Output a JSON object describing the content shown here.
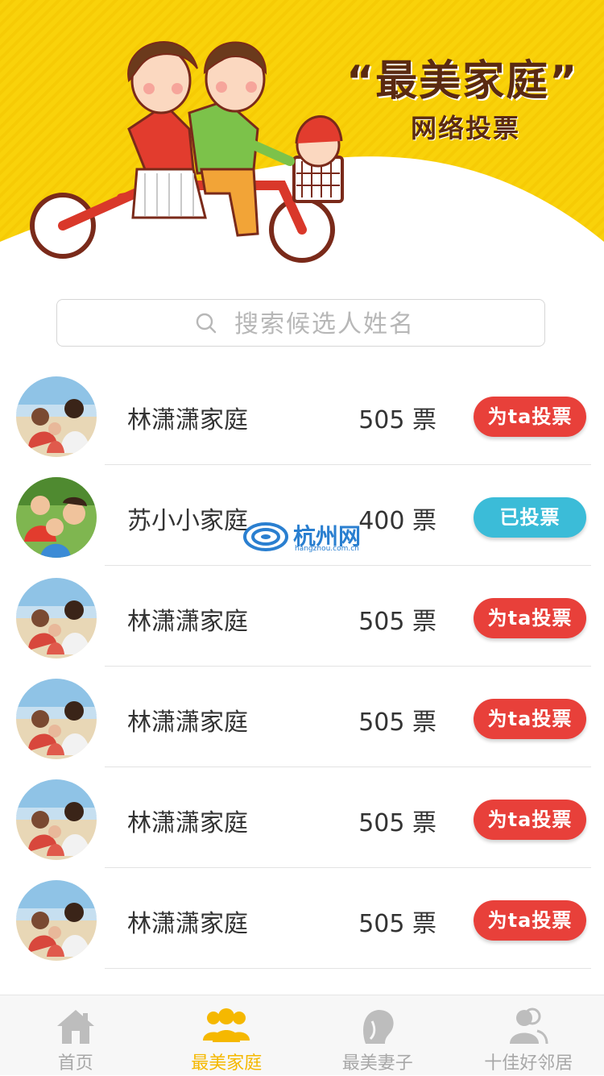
{
  "colors": {
    "banner_yellow": "#f9d20a",
    "accent_red": "#e8403a",
    "voted_blue": "#3bbcd8",
    "tab_active": "#f5b800",
    "tab_inactive": "#a8a8a8"
  },
  "banner": {
    "title": "“最美家庭”",
    "subtitle": "网络投票"
  },
  "search": {
    "placeholder": "搜索候选人姓名",
    "value": ""
  },
  "candidates": [
    {
      "name": "林潇潇家庭",
      "votes": "505 票",
      "action": "为ta投票",
      "state": "vote",
      "avatar": "family-beach-photo"
    },
    {
      "name": "苏小小家庭",
      "votes": "400 票",
      "action": "已投票",
      "state": "voted",
      "avatar": "family-park-photo"
    },
    {
      "name": "林潇潇家庭",
      "votes": "505 票",
      "action": "为ta投票",
      "state": "vote",
      "avatar": "family-beach-photo"
    },
    {
      "name": "林潇潇家庭",
      "votes": "505 票",
      "action": "为ta投票",
      "state": "vote",
      "avatar": "family-beach-photo"
    },
    {
      "name": "林潇潇家庭",
      "votes": "505 票",
      "action": "为ta投票",
      "state": "vote",
      "avatar": "family-beach-photo"
    },
    {
      "name": "林潇潇家庭",
      "votes": "505 票",
      "action": "为ta投票",
      "state": "vote",
      "avatar": "family-beach-photo"
    }
  ],
  "watermark": {
    "brand": "杭州网",
    "domain": "hangzhou.com.cn"
  },
  "tabs": [
    {
      "label": "首页",
      "icon": "home-icon",
      "active": false
    },
    {
      "label": "最美家庭",
      "icon": "family-group-icon",
      "active": true
    },
    {
      "label": "最美妻子",
      "icon": "woman-profile-icon",
      "active": false
    },
    {
      "label": "十佳好邻居",
      "icon": "neighbors-icon",
      "active": false
    }
  ]
}
